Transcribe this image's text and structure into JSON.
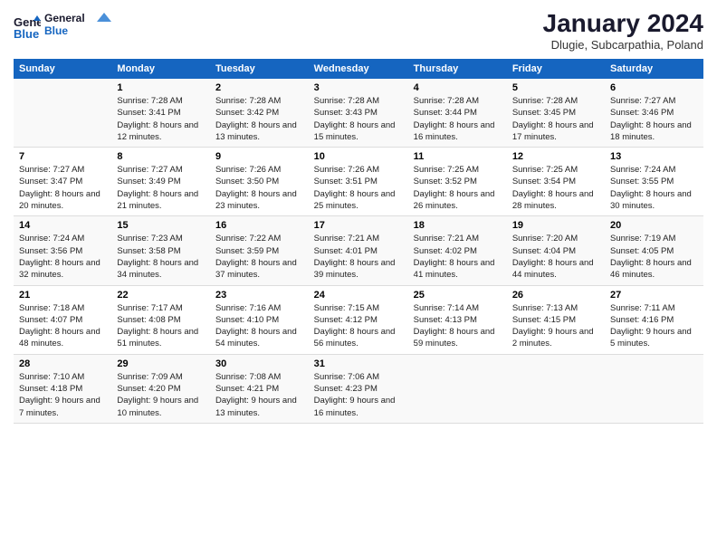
{
  "header": {
    "logo_line1": "General",
    "logo_line2": "Blue",
    "month": "January 2024",
    "location": "Dlugie, Subcarpathia, Poland"
  },
  "weekdays": [
    "Sunday",
    "Monday",
    "Tuesday",
    "Wednesday",
    "Thursday",
    "Friday",
    "Saturday"
  ],
  "weeks": [
    [
      {
        "day": "",
        "sunrise": "",
        "sunset": "",
        "daylight": ""
      },
      {
        "day": "1",
        "sunrise": "Sunrise: 7:28 AM",
        "sunset": "Sunset: 3:41 PM",
        "daylight": "Daylight: 8 hours and 12 minutes."
      },
      {
        "day": "2",
        "sunrise": "Sunrise: 7:28 AM",
        "sunset": "Sunset: 3:42 PM",
        "daylight": "Daylight: 8 hours and 13 minutes."
      },
      {
        "day": "3",
        "sunrise": "Sunrise: 7:28 AM",
        "sunset": "Sunset: 3:43 PM",
        "daylight": "Daylight: 8 hours and 15 minutes."
      },
      {
        "day": "4",
        "sunrise": "Sunrise: 7:28 AM",
        "sunset": "Sunset: 3:44 PM",
        "daylight": "Daylight: 8 hours and 16 minutes."
      },
      {
        "day": "5",
        "sunrise": "Sunrise: 7:28 AM",
        "sunset": "Sunset: 3:45 PM",
        "daylight": "Daylight: 8 hours and 17 minutes."
      },
      {
        "day": "6",
        "sunrise": "Sunrise: 7:27 AM",
        "sunset": "Sunset: 3:46 PM",
        "daylight": "Daylight: 8 hours and 18 minutes."
      }
    ],
    [
      {
        "day": "7",
        "sunrise": "Sunrise: 7:27 AM",
        "sunset": "Sunset: 3:47 PM",
        "daylight": "Daylight: 8 hours and 20 minutes."
      },
      {
        "day": "8",
        "sunrise": "Sunrise: 7:27 AM",
        "sunset": "Sunset: 3:49 PM",
        "daylight": "Daylight: 8 hours and 21 minutes."
      },
      {
        "day": "9",
        "sunrise": "Sunrise: 7:26 AM",
        "sunset": "Sunset: 3:50 PM",
        "daylight": "Daylight: 8 hours and 23 minutes."
      },
      {
        "day": "10",
        "sunrise": "Sunrise: 7:26 AM",
        "sunset": "Sunset: 3:51 PM",
        "daylight": "Daylight: 8 hours and 25 minutes."
      },
      {
        "day": "11",
        "sunrise": "Sunrise: 7:25 AM",
        "sunset": "Sunset: 3:52 PM",
        "daylight": "Daylight: 8 hours and 26 minutes."
      },
      {
        "day": "12",
        "sunrise": "Sunrise: 7:25 AM",
        "sunset": "Sunset: 3:54 PM",
        "daylight": "Daylight: 8 hours and 28 minutes."
      },
      {
        "day": "13",
        "sunrise": "Sunrise: 7:24 AM",
        "sunset": "Sunset: 3:55 PM",
        "daylight": "Daylight: 8 hours and 30 minutes."
      }
    ],
    [
      {
        "day": "14",
        "sunrise": "Sunrise: 7:24 AM",
        "sunset": "Sunset: 3:56 PM",
        "daylight": "Daylight: 8 hours and 32 minutes."
      },
      {
        "day": "15",
        "sunrise": "Sunrise: 7:23 AM",
        "sunset": "Sunset: 3:58 PM",
        "daylight": "Daylight: 8 hours and 34 minutes."
      },
      {
        "day": "16",
        "sunrise": "Sunrise: 7:22 AM",
        "sunset": "Sunset: 3:59 PM",
        "daylight": "Daylight: 8 hours and 37 minutes."
      },
      {
        "day": "17",
        "sunrise": "Sunrise: 7:21 AM",
        "sunset": "Sunset: 4:01 PM",
        "daylight": "Daylight: 8 hours and 39 minutes."
      },
      {
        "day": "18",
        "sunrise": "Sunrise: 7:21 AM",
        "sunset": "Sunset: 4:02 PM",
        "daylight": "Daylight: 8 hours and 41 minutes."
      },
      {
        "day": "19",
        "sunrise": "Sunrise: 7:20 AM",
        "sunset": "Sunset: 4:04 PM",
        "daylight": "Daylight: 8 hours and 44 minutes."
      },
      {
        "day": "20",
        "sunrise": "Sunrise: 7:19 AM",
        "sunset": "Sunset: 4:05 PM",
        "daylight": "Daylight: 8 hours and 46 minutes."
      }
    ],
    [
      {
        "day": "21",
        "sunrise": "Sunrise: 7:18 AM",
        "sunset": "Sunset: 4:07 PM",
        "daylight": "Daylight: 8 hours and 48 minutes."
      },
      {
        "day": "22",
        "sunrise": "Sunrise: 7:17 AM",
        "sunset": "Sunset: 4:08 PM",
        "daylight": "Daylight: 8 hours and 51 minutes."
      },
      {
        "day": "23",
        "sunrise": "Sunrise: 7:16 AM",
        "sunset": "Sunset: 4:10 PM",
        "daylight": "Daylight: 8 hours and 54 minutes."
      },
      {
        "day": "24",
        "sunrise": "Sunrise: 7:15 AM",
        "sunset": "Sunset: 4:12 PM",
        "daylight": "Daylight: 8 hours and 56 minutes."
      },
      {
        "day": "25",
        "sunrise": "Sunrise: 7:14 AM",
        "sunset": "Sunset: 4:13 PM",
        "daylight": "Daylight: 8 hours and 59 minutes."
      },
      {
        "day": "26",
        "sunrise": "Sunrise: 7:13 AM",
        "sunset": "Sunset: 4:15 PM",
        "daylight": "Daylight: 9 hours and 2 minutes."
      },
      {
        "day": "27",
        "sunrise": "Sunrise: 7:11 AM",
        "sunset": "Sunset: 4:16 PM",
        "daylight": "Daylight: 9 hours and 5 minutes."
      }
    ],
    [
      {
        "day": "28",
        "sunrise": "Sunrise: 7:10 AM",
        "sunset": "Sunset: 4:18 PM",
        "daylight": "Daylight: 9 hours and 7 minutes."
      },
      {
        "day": "29",
        "sunrise": "Sunrise: 7:09 AM",
        "sunset": "Sunset: 4:20 PM",
        "daylight": "Daylight: 9 hours and 10 minutes."
      },
      {
        "day": "30",
        "sunrise": "Sunrise: 7:08 AM",
        "sunset": "Sunset: 4:21 PM",
        "daylight": "Daylight: 9 hours and 13 minutes."
      },
      {
        "day": "31",
        "sunrise": "Sunrise: 7:06 AM",
        "sunset": "Sunset: 4:23 PM",
        "daylight": "Daylight: 9 hours and 16 minutes."
      },
      {
        "day": "",
        "sunrise": "",
        "sunset": "",
        "daylight": ""
      },
      {
        "day": "",
        "sunrise": "",
        "sunset": "",
        "daylight": ""
      },
      {
        "day": "",
        "sunrise": "",
        "sunset": "",
        "daylight": ""
      }
    ]
  ]
}
